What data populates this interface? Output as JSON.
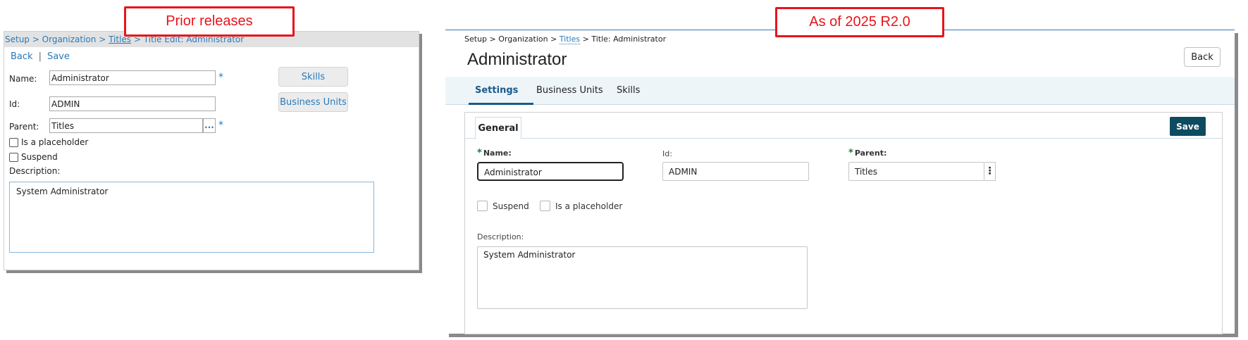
{
  "callouts": {
    "left": "Prior releases",
    "right": "As of 2025 R2.0"
  },
  "old_ui": {
    "breadcrumb": {
      "setup": "Setup",
      "organization": "Organization",
      "titles": "Titles",
      "current": "Title Edit: Administrator",
      "separator": ">"
    },
    "links": {
      "back": "Back",
      "separator": "|",
      "save": "Save"
    },
    "fields": {
      "name_label": "Name:",
      "name_value": "Administrator",
      "id_label": "Id:",
      "id_value": "ADMIN",
      "parent_label": "Parent:",
      "parent_value": "Titles",
      "required_mark": "*",
      "lookup_button": "..."
    },
    "checkboxes": {
      "placeholder": "Is a placeholder",
      "suspend": "Suspend"
    },
    "description_label": "Description:",
    "description_value": "System Administrator",
    "buttons": {
      "skills": "Skills",
      "business_units": "Business Units"
    }
  },
  "new_ui": {
    "breadcrumb": {
      "setup": "Setup",
      "organization": "Organization",
      "titles": "Titles",
      "current": "Title: Administrator",
      "separator": ">"
    },
    "page_title": "Administrator",
    "back_button": "Back",
    "tabs": [
      "Settings",
      "Business Units",
      "Skills"
    ],
    "active_tab": "Settings",
    "card_tab": "General",
    "save_button": "Save",
    "fields": {
      "required_mark": "*",
      "name_label": "Name:",
      "name_value": "Administrator",
      "id_label": "Id:",
      "id_value": "ADMIN",
      "parent_label": "Parent:",
      "parent_value": "Titles",
      "kebab": "⋮"
    },
    "checkboxes": {
      "suspend": "Suspend",
      "placeholder": "Is a placeholder"
    },
    "description_label": "Description:",
    "description_value": "System Administrator"
  }
}
